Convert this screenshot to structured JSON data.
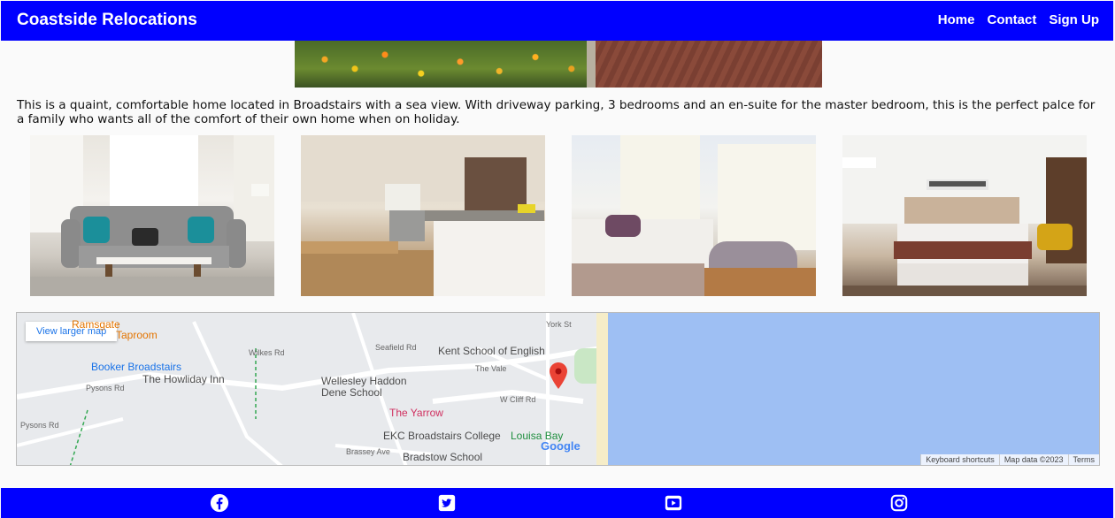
{
  "navbar": {
    "brand": "Coastside Relocations",
    "links": [
      "Home",
      "Contact",
      "Sign Up"
    ],
    "background": "#0000ff"
  },
  "property": {
    "description": "This is a quaint, comfortable home located in Broadstairs with a sea view. With driveway parking, 3 bedrooms and an en-suite for the master bedroom, this is the perfect palce for a family who wants all of the comfort of their own home when on holiday."
  },
  "gallery": {
    "photos": [
      "living-room",
      "kitchen",
      "bedroom",
      "master-bedroom"
    ]
  },
  "map": {
    "view_larger": "View larger map",
    "labels": {
      "ramsgate_top": "Ramsgate",
      "taproom": "Taproom",
      "booker": "Booker Broadstairs",
      "howliday": "The Howliday Inn",
      "wellesley1": "Wellesley Haddon",
      "wellesley2": "Dene School",
      "kent_school": "Kent School of English",
      "yarrow": "The Yarrow",
      "ekc": "EKC Broadstairs College",
      "louisa": "Louisa Bay",
      "bradstow": "Bradstow School",
      "w_cliff": "W Cliff Rd",
      "the_vale": "The Vale",
      "seafield": "Seafield Rd",
      "wilkes": "Wilkes Rd",
      "pysons1": "Pysons Rd",
      "pysons2": "Pysons Rd",
      "brassey": "Brassey Ave",
      "york": "York St",
      "google": "Google"
    },
    "footer": [
      "Keyboard shortcuts",
      "Map data ©2023",
      "Terms"
    ]
  },
  "footer": {
    "icons": [
      "facebook-icon",
      "twitter-icon",
      "youtube-icon",
      "instagram-icon"
    ],
    "background": "#0000ff"
  }
}
